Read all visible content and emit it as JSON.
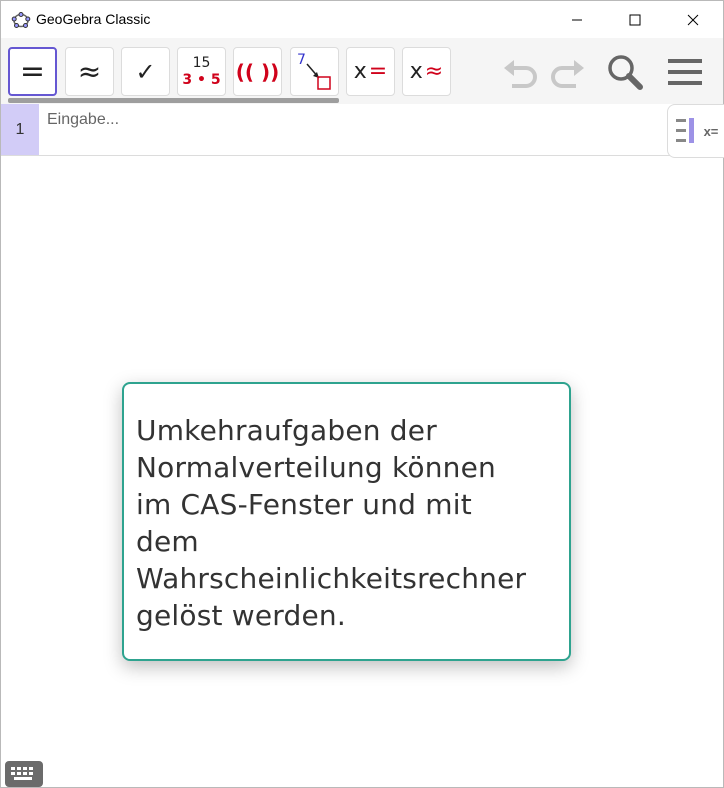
{
  "window": {
    "title": "GeoGebra Classic",
    "controls": {
      "minimize_icon": "minimize-icon",
      "maximize_icon": "maximize-icon",
      "close_icon": "close-icon"
    }
  },
  "toolbar": {
    "tools": [
      {
        "id": "evaluate",
        "label": "=",
        "selected": true
      },
      {
        "id": "numeric",
        "label": "≈",
        "selected": false
      },
      {
        "id": "keep-input",
        "label": "✓",
        "selected": false
      },
      {
        "id": "factor",
        "label_top": "15",
        "label_bottom": "3 • 5",
        "selected": false
      },
      {
        "id": "expand",
        "label": "(( ))",
        "selected": false
      },
      {
        "id": "substitute",
        "label": "7",
        "selected": false
      },
      {
        "id": "solve",
        "label_x": "x",
        "label_op": "=",
        "selected": false
      },
      {
        "id": "solve-numeric",
        "label_x": "x",
        "label_op": "≈",
        "selected": false
      }
    ],
    "undo_icon": "undo-icon",
    "redo_icon": "redo-icon",
    "search_icon": "search-icon",
    "menu_icon": "menu-icon"
  },
  "algebra": {
    "row_number": "1",
    "input_placeholder": "Eingabe..."
  },
  "side_toggle": {
    "icon": "algebra-view-icon",
    "label": "x="
  },
  "tooltip": {
    "lines": [
      "Umkehraufgaben der",
      "Normalverteilung können",
      "im CAS-Fenster und mit",
      "dem",
      "Wahrscheinlichkeitsrechner",
      "gelöst werden."
    ]
  },
  "keyboard": {
    "icon": "keyboard-icon"
  },
  "colors": {
    "accent": "#6557d2",
    "row_highlight": "#d2ccf7",
    "card_border": "#2ea38f",
    "red": "#d0021b"
  }
}
